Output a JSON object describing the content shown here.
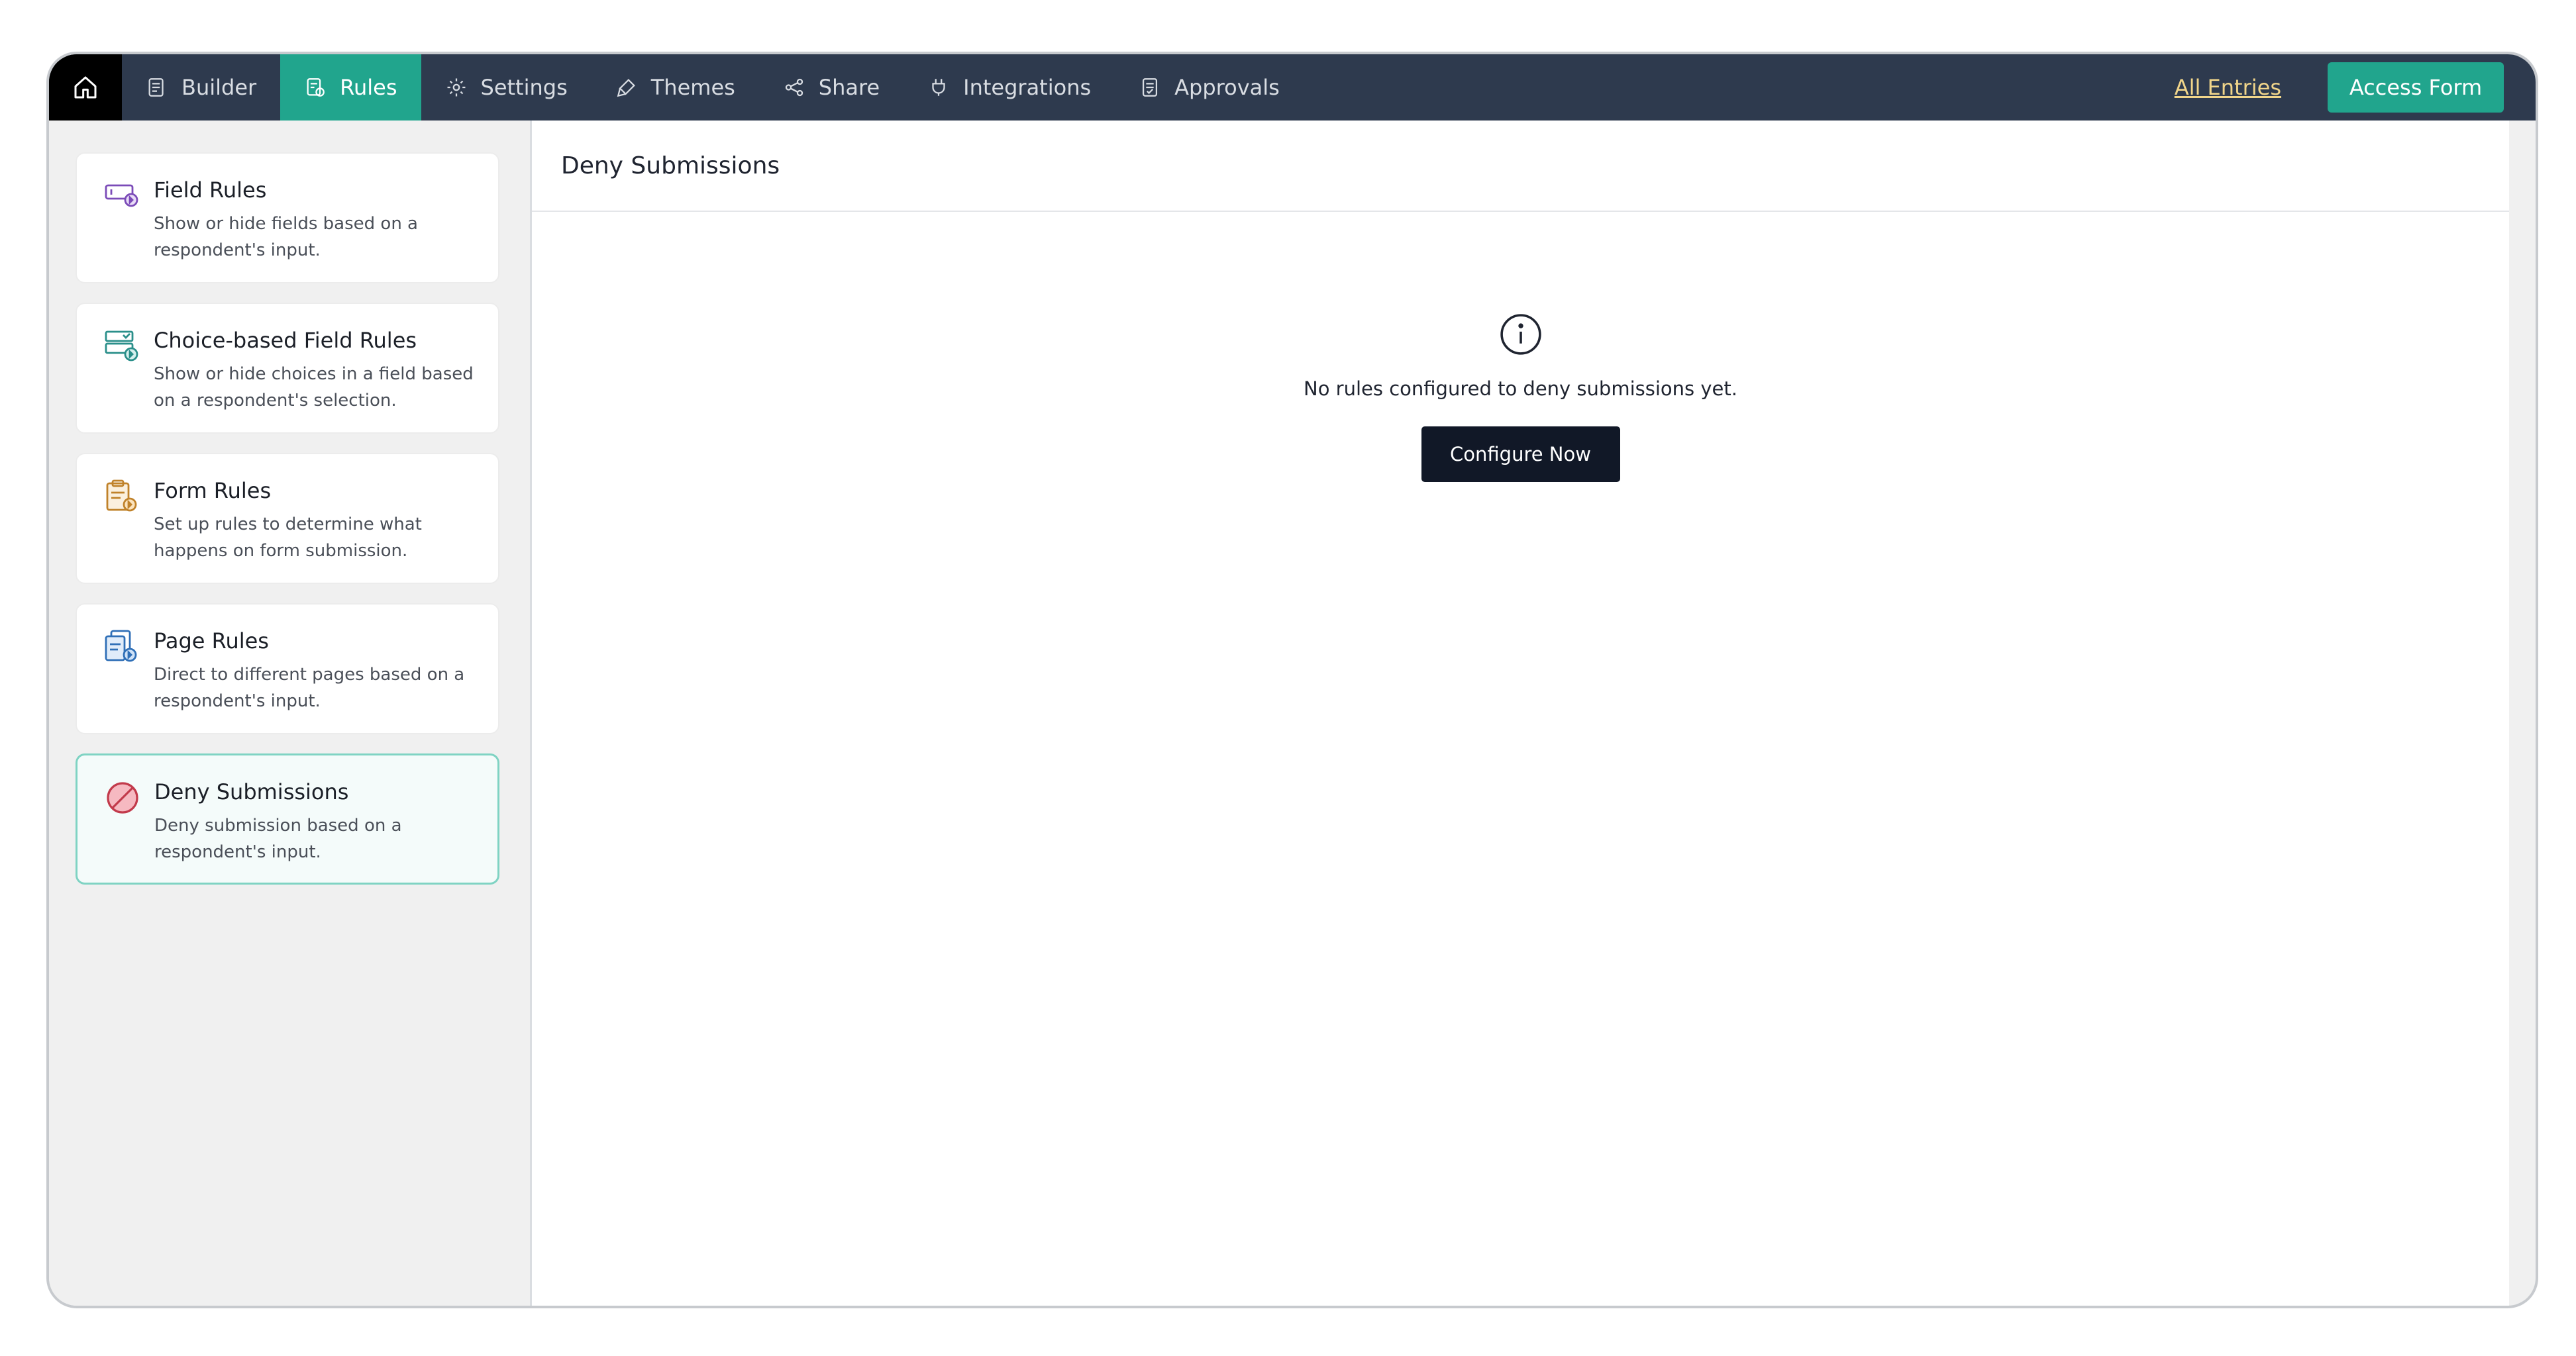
{
  "nav": {
    "home_icon": "home-icon",
    "items": [
      {
        "label": "Builder",
        "icon": "builder-icon"
      },
      {
        "label": "Rules",
        "icon": "rules-icon",
        "active": true
      },
      {
        "label": "Settings",
        "icon": "gear-icon"
      },
      {
        "label": "Themes",
        "icon": "brush-icon"
      },
      {
        "label": "Share",
        "icon": "share-icon"
      },
      {
        "label": "Integrations",
        "icon": "plug-icon"
      },
      {
        "label": "Approvals",
        "icon": "approvals-icon"
      }
    ],
    "all_entries_label": "All Entries",
    "access_form_label": "Access Form"
  },
  "sidebar": {
    "cards": [
      {
        "title": "Field Rules",
        "desc": "Show or hide fields based on a respondent's input.",
        "icon": "field-rules-icon"
      },
      {
        "title": "Choice-based Field Rules",
        "desc": "Show or hide choices in a field based on a respondent's selection.",
        "icon": "choice-rules-icon"
      },
      {
        "title": "Form Rules",
        "desc": "Set up rules to determine what happens on form submission.",
        "icon": "form-rules-icon"
      },
      {
        "title": "Page Rules",
        "desc": "Direct to different pages based on a respondent's input.",
        "icon": "page-rules-icon"
      },
      {
        "title": "Deny Submissions",
        "desc": "Deny submission based on a respondent's input.",
        "icon": "deny-icon",
        "active": true
      }
    ]
  },
  "main": {
    "title": "Deny Submissions",
    "empty_message": "No rules configured to deny submissions yet.",
    "empty_icon": "info-icon",
    "configure_label": "Configure Now"
  },
  "colors": {
    "topbar": "#2e3a4e",
    "accent": "#21a58d",
    "link": "#f1d58a",
    "primary_button": "#111827"
  }
}
